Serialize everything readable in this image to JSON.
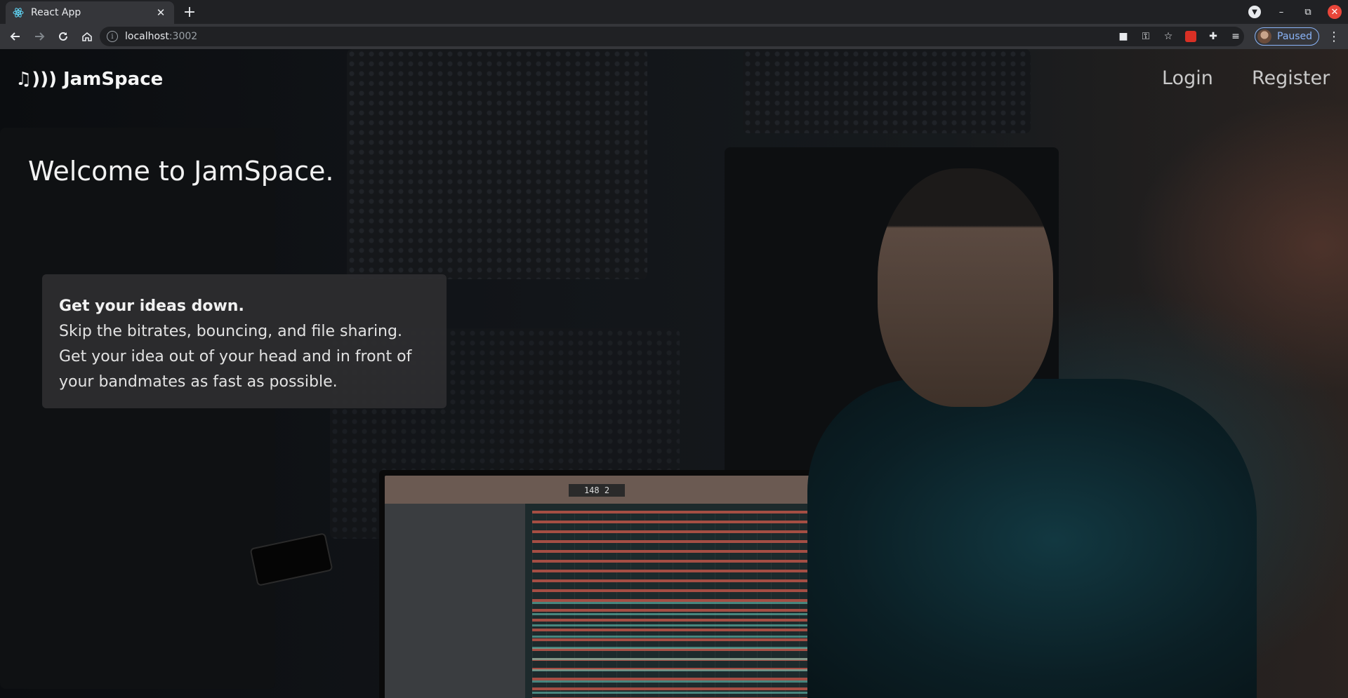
{
  "browser": {
    "tab": {
      "title": "React App",
      "close_glyph": "✕",
      "favicon": "react-logo-icon"
    },
    "new_tab_glyph": "+",
    "url": {
      "host": "localhost",
      "port": ":3002"
    },
    "profile": {
      "label": "Paused"
    },
    "window": {
      "minimize": "–",
      "restore": "⧉",
      "close": "✕"
    }
  },
  "app": {
    "brand": "♫))) JamSpace",
    "nav": {
      "login": "Login",
      "register": "Register"
    },
    "hero": {
      "title": "Welcome to JamSpace."
    },
    "card": {
      "heading": "Get your ideas down.",
      "body": "Skip the bitrates, bouncing, and file sharing. Get your idea out of your head and in front of your bandmates as fast as possible."
    }
  },
  "image_screen": {
    "tempo_display": "148 2"
  },
  "colors": {
    "accent": "#8ab4f8",
    "close_button": "#e9463a",
    "card_bg": "#2e2e30"
  }
}
